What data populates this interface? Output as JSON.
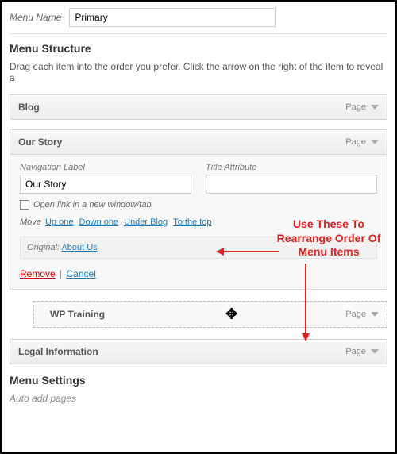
{
  "menu": {
    "name_label": "Menu Name",
    "name_value": "Primary"
  },
  "structure": {
    "heading": "Menu Structure",
    "help": "Drag each item into the order you prefer. Click the arrow on the right of the item to reveal a"
  },
  "items": {
    "blog": {
      "title": "Blog",
      "type": "Page"
    },
    "story": {
      "title": "Our Story",
      "type": "Page",
      "nav_label_caption": "Navigation Label",
      "nav_label_value": "Our Story",
      "title_attr_caption": "Title Attribute",
      "title_attr_value": "",
      "new_tab_label": "Open link in a new window/tab",
      "move_label": "Move",
      "move_up": "Up one",
      "move_down": "Down one",
      "move_under": "Under Blog",
      "move_top": "To the top",
      "original_label": "Original:",
      "original_link": "About Us",
      "remove": "Remove",
      "cancel": "Cancel"
    },
    "wp": {
      "title": "WP Training",
      "type": "Page"
    },
    "legal": {
      "title": "Legal Information",
      "type": "Page"
    }
  },
  "settings": {
    "heading": "Menu Settings",
    "auto_add": "Auto add pages"
  },
  "annotation": {
    "text": "Use These To Rearrange Order Of Menu Items"
  }
}
